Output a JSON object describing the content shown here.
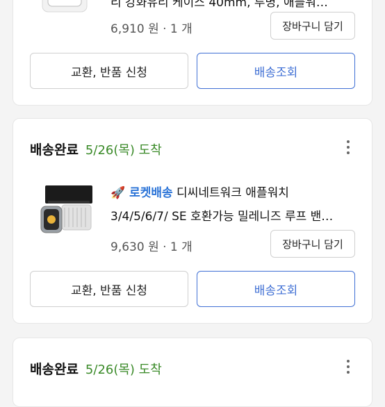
{
  "orders": [
    {
      "status": "",
      "arrival": "",
      "rocket_label": "",
      "title_line1": "",
      "title_line2": "리 강화유리 케이스 40mm, 투명, 애플워…",
      "price": "6,910 원 · 1 개",
      "cart_label": "장바구니 담기",
      "exchange_label": "교환, 반품 신청",
      "track_label": "배송조회"
    },
    {
      "status": "배송완료",
      "arrival": "5/26(목) 도착",
      "rocket_label": "🚀 로켓배송",
      "title_line1": " 디씨네트워크 애플워치",
      "title_line2": "3/4/5/6/7/ SE 호환가능 밀레니즈 루프 밴…",
      "price": "9,630 원 · 1 개",
      "cart_label": "장바구니 담기",
      "exchange_label": "교환, 반품 신청",
      "track_label": "배송조회"
    },
    {
      "status": "배송완료",
      "arrival": "5/26(목) 도착"
    }
  ],
  "icons": {
    "more": "kebab-menu-icon",
    "rocket": "rocket-icon"
  },
  "colors": {
    "arrival_green": "#3a8a28",
    "track_blue": "#3f6fd4",
    "rocket_blue": "#2a73d7"
  }
}
